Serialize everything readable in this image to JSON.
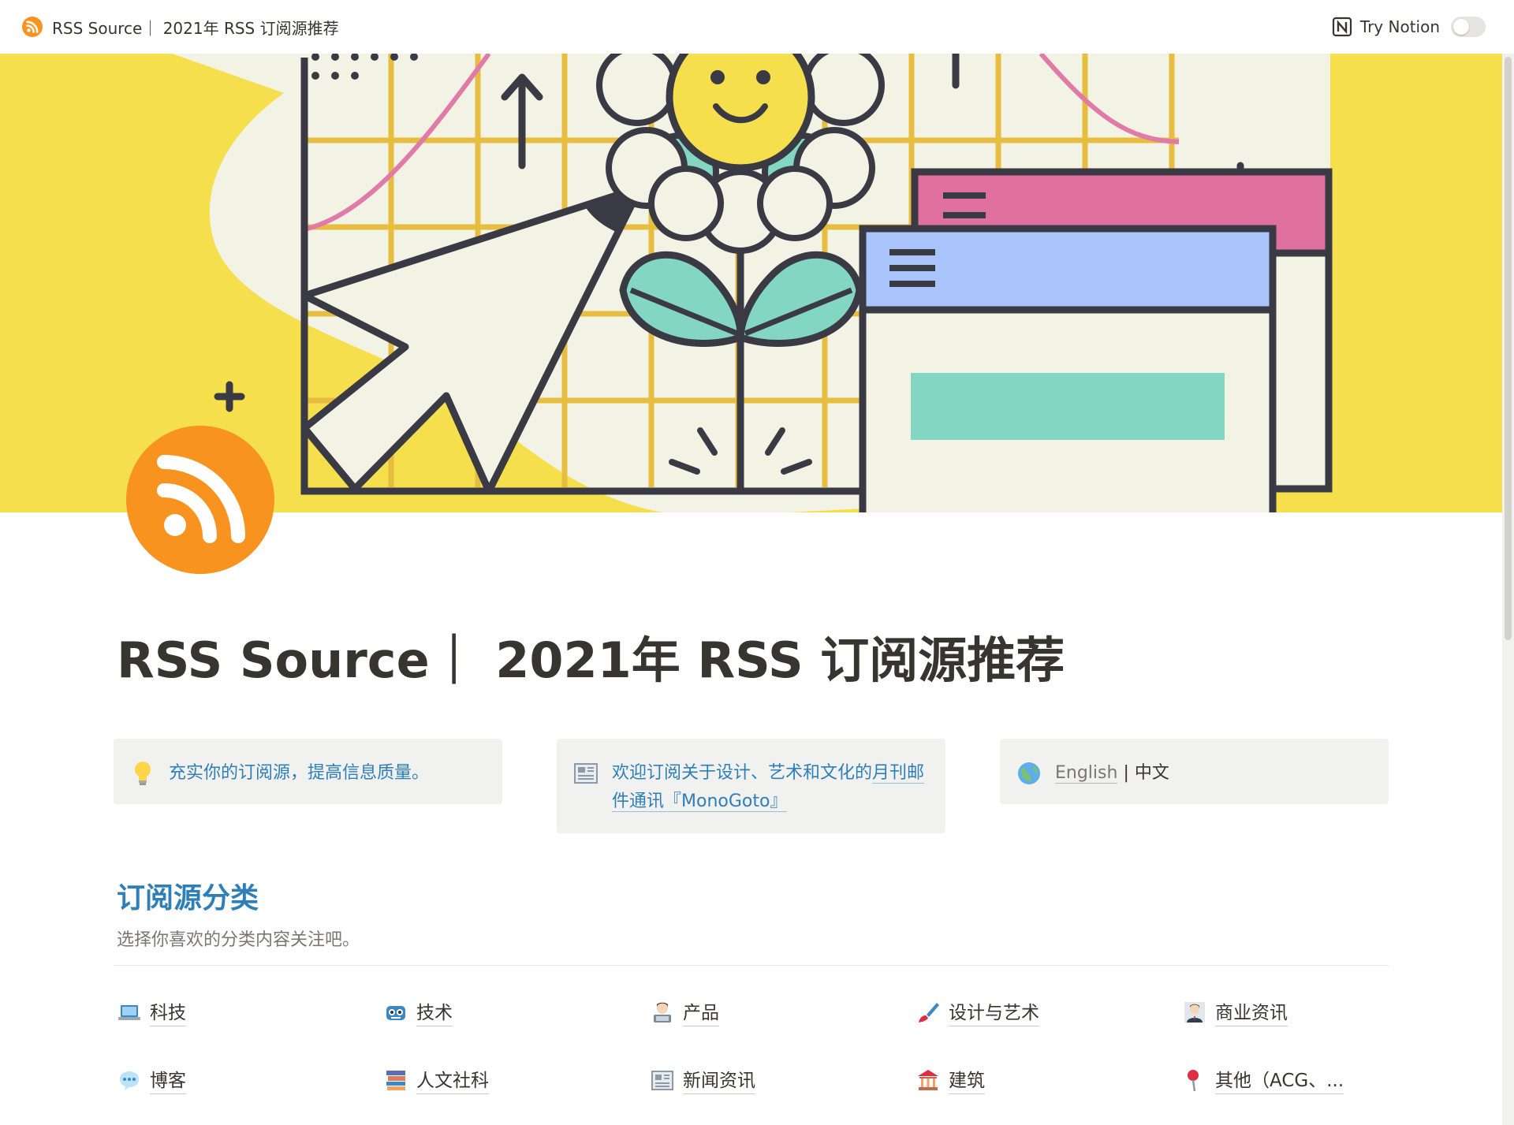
{
  "topbar": {
    "breadcrumb": "RSS Source｜ 2021年 RSS 订阅源推荐",
    "try_notion": "Try Notion"
  },
  "page": {
    "title": "RSS Source｜ 2021年 RSS 订阅源推荐"
  },
  "callouts": {
    "tagline": "充实你的订阅源，提高信息质量。",
    "newsletter_prefix": "欢迎订阅关于设计、艺术和文化的",
    "newsletter_link": "月刊邮件通讯『MonoGoto』",
    "lang_english": "English",
    "lang_sep": " | ",
    "lang_chinese": "中文"
  },
  "section": {
    "title": "订阅源分类",
    "description": "选择你喜欢的分类内容关注吧。"
  },
  "categories": [
    {
      "label": "科技",
      "icon": "laptop-icon"
    },
    {
      "label": "技术",
      "icon": "robot-icon"
    },
    {
      "label": "产品",
      "icon": "technologist-icon"
    },
    {
      "label": "设计与艺术",
      "icon": "paintbrush-icon"
    },
    {
      "label": "商业资讯",
      "icon": "businessman-icon"
    },
    {
      "label": "博客",
      "icon": "speech-balloon-icon"
    },
    {
      "label": "人文社科",
      "icon": "books-icon"
    },
    {
      "label": "新闻资讯",
      "icon": "newspaper-icon"
    },
    {
      "label": "建筑",
      "icon": "classical-building-icon"
    },
    {
      "label": "其他（ACG、...",
      "icon": "pushpin-icon"
    }
  ],
  "colors": {
    "accent_blue": "#2e7fb8",
    "cover_yellow": "#f5df4d",
    "rss_orange": "#f7931e"
  }
}
